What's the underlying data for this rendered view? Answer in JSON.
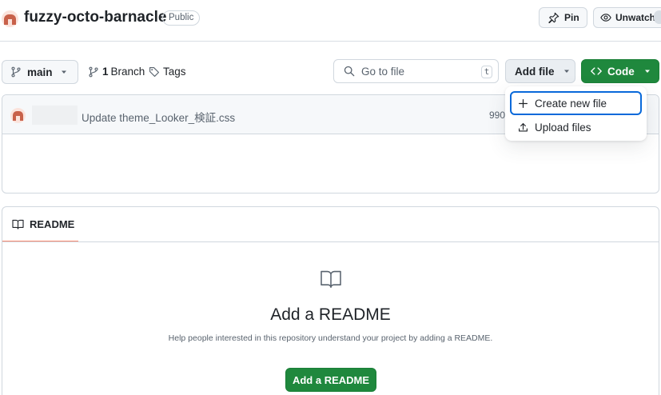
{
  "repo": {
    "name": "fuzzy-octo-barnacle",
    "visibility": "Public",
    "avatar_icon": "identicon-avatar"
  },
  "header_actions": {
    "pin_label": "Pin",
    "watch_label": "Unwatch"
  },
  "toolbar": {
    "branch_name": "main",
    "branch_count": "1",
    "branch_label": "Branch",
    "tags_label": "Tags",
    "goto_placeholder": "Go to file",
    "goto_shortcut": "t",
    "add_file_label": "Add file",
    "code_label": "Code"
  },
  "add_file_menu": {
    "items": [
      {
        "label": "Create new file",
        "icon": "plus-icon",
        "focused": true
      },
      {
        "label": "Upload files",
        "icon": "upload-icon",
        "focused": false
      }
    ]
  },
  "latest_commit": {
    "message": "Update theme_Looker_検証.css",
    "hash": "990f"
  },
  "readme": {
    "tab_label": "README",
    "heading": "Add a README",
    "help_text": "Help people interested in this repository understand your project by adding a README.",
    "button_label": "Add a README"
  },
  "colors": {
    "primary_green": "#1f883d",
    "focus_blue": "#0969da",
    "tab_underline": "#fd8c73",
    "border": "#d0d7de"
  }
}
